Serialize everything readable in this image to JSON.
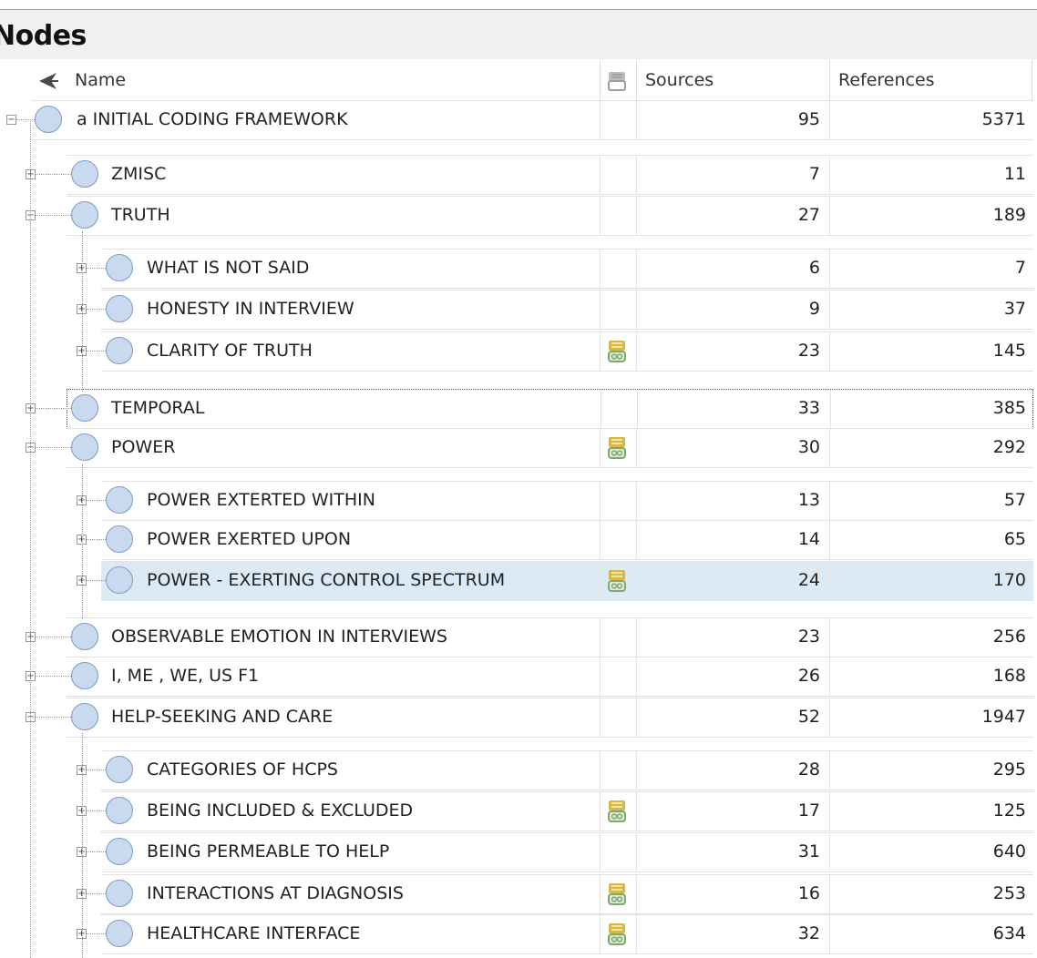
{
  "panel": {
    "title": "Nodes"
  },
  "columns": {
    "name": "Name",
    "sources": "Sources",
    "references": "References"
  },
  "colors": {
    "selected_row": "#dceaf6",
    "node_fill": "#c9d9ee",
    "node_border": "#7a9cc8",
    "memo_icon": "#d7b64a"
  },
  "rows": [
    {
      "name": "a INITIAL CODING FRAMEWORK",
      "sources": "95",
      "references": "5371",
      "level": 0,
      "expander": "−",
      "memo": false
    },
    {
      "name": "ZMISC",
      "sources": "7",
      "references": "11",
      "level": 1,
      "expander": "+",
      "memo": false
    },
    {
      "name": "TRUTH",
      "sources": "27",
      "references": "189",
      "level": 1,
      "expander": "−",
      "memo": false
    },
    {
      "name": "WHAT IS NOT SAID",
      "sources": "6",
      "references": "7",
      "level": 2,
      "expander": "+",
      "memo": false
    },
    {
      "name": "HONESTY IN INTERVIEW",
      "sources": "9",
      "references": "37",
      "level": 2,
      "expander": "+",
      "memo": false
    },
    {
      "name": "CLARITY OF TRUTH",
      "sources": "23",
      "references": "145",
      "level": 2,
      "expander": "+",
      "memo": true
    },
    {
      "name": "TEMPORAL",
      "sources": "33",
      "references": "385",
      "level": 1,
      "expander": "+",
      "memo": false,
      "focused": true
    },
    {
      "name": "POWER",
      "sources": "30",
      "references": "292",
      "level": 1,
      "expander": "−",
      "memo": true
    },
    {
      "name": "POWER EXTERTED WITHIN",
      "sources": "13",
      "references": "57",
      "level": 2,
      "expander": "+",
      "memo": false
    },
    {
      "name": "POWER EXERTED UPON",
      "sources": "14",
      "references": "65",
      "level": 2,
      "expander": "+",
      "memo": false
    },
    {
      "name": "POWER - EXERTING CONTROL SPECTRUM",
      "sources": "24",
      "references": "170",
      "level": 2,
      "expander": "+",
      "memo": true,
      "selected": true
    },
    {
      "name": "OBSERVABLE EMOTION IN INTERVIEWS",
      "sources": "23",
      "references": "256",
      "level": 1,
      "expander": "+",
      "memo": false
    },
    {
      "name": "I, ME , WE, US F1",
      "sources": "26",
      "references": "168",
      "level": 1,
      "expander": "+",
      "memo": false
    },
    {
      "name": "HELP-SEEKING AND CARE",
      "sources": "52",
      "references": "1947",
      "level": 1,
      "expander": "−",
      "memo": false
    },
    {
      "name": "CATEGORIES OF HCPS",
      "sources": "28",
      "references": "295",
      "level": 2,
      "expander": "+",
      "memo": false
    },
    {
      "name": "BEING INCLUDED & EXCLUDED",
      "sources": "17",
      "references": "125",
      "level": 2,
      "expander": "+",
      "memo": true
    },
    {
      "name": "BEING PERMEABLE TO HELP",
      "sources": "31",
      "references": "640",
      "level": 2,
      "expander": "+",
      "memo": false
    },
    {
      "name": "INTERACTIONS AT DIAGNOSIS",
      "sources": "16",
      "references": "253",
      "level": 2,
      "expander": "+",
      "memo": true
    },
    {
      "name": "HEALTHCARE INTERFACE",
      "sources": "32",
      "references": "634",
      "level": 2,
      "expander": "+",
      "memo": true
    }
  ]
}
